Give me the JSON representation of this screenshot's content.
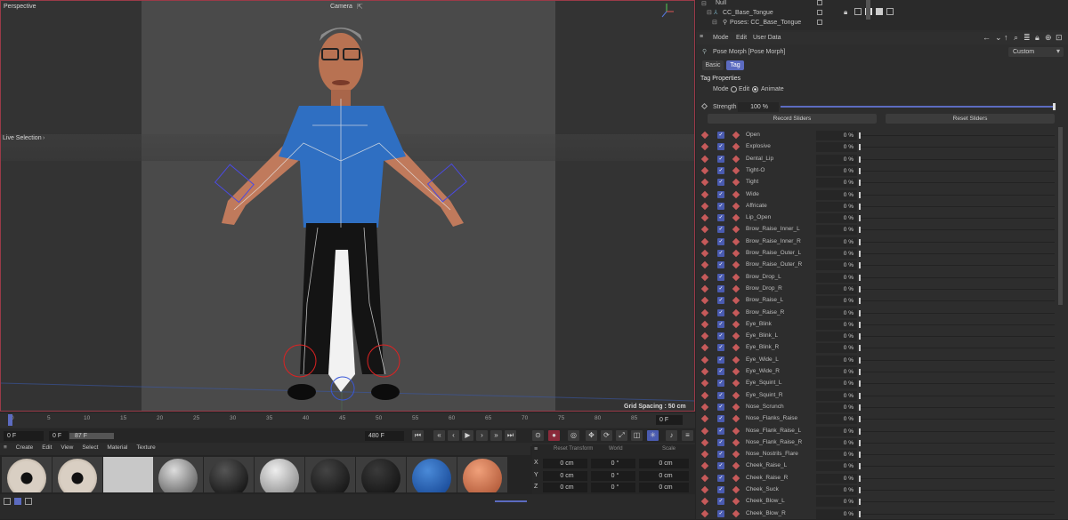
{
  "viewport": {
    "label_perspective": "Perspective",
    "label_camera": "Camera",
    "label_live_selection": "Live Selection",
    "grid_spacing": "Grid Spacing : 50 cm"
  },
  "timeline": {
    "ticks": [
      "0",
      "5",
      "10",
      "15",
      "20",
      "25",
      "30",
      "35",
      "40",
      "45",
      "50",
      "55",
      "60",
      "65",
      "70",
      "75",
      "80",
      "85",
      "90"
    ],
    "current_frame": "0 F",
    "field_start": "0 F",
    "field_min": "0 F",
    "field_max": "87 F",
    "field_end": "480 F"
  },
  "material_menu": [
    "Create",
    "Edit",
    "View",
    "Select",
    "Material",
    "Texture"
  ],
  "coords": {
    "headers": [
      "Reset Transform",
      "World",
      "Scale"
    ],
    "rows": [
      {
        "axis": "X",
        "pos": "0 cm",
        "rot": "0 °",
        "scale": "0 cm"
      },
      {
        "axis": "Y",
        "pos": "0 cm",
        "rot": "0 °",
        "scale": "0 cm"
      },
      {
        "axis": "Z",
        "pos": "0 cm",
        "rot": "0 °",
        "scale": "0 cm"
      }
    ]
  },
  "object_manager": {
    "items": [
      "Null",
      "CC_Base_Tongue",
      "Poses: CC_Base_Tongue"
    ]
  },
  "attributes": {
    "menu": [
      "Mode",
      "Edit",
      "User Data"
    ],
    "title": "Pose Morph [Pose Morph]",
    "preset": "Custom",
    "tabs": [
      "Basic",
      "Tag"
    ],
    "section": "Tag Properties",
    "mode_label": "Mode",
    "mode_edit": "Edit",
    "mode_animate": "Animate",
    "strength_label": "Strength",
    "strength_value": "100 %",
    "strength_fraction": 1.0,
    "record_btn": "Record Sliders",
    "reset_btn": "Reset Sliders"
  },
  "morphs": [
    {
      "name": "Open",
      "value": "0 %"
    },
    {
      "name": "Explosive",
      "value": "0 %"
    },
    {
      "name": "Dental_Lip",
      "value": "0 %"
    },
    {
      "name": "Tight-O",
      "value": "0 %"
    },
    {
      "name": "Tight",
      "value": "0 %"
    },
    {
      "name": "Wide",
      "value": "0 %"
    },
    {
      "name": "Affricate",
      "value": "0 %"
    },
    {
      "name": "Lip_Open",
      "value": "0 %"
    },
    {
      "name": "Brow_Raise_Inner_L",
      "value": "0 %"
    },
    {
      "name": "Brow_Raise_Inner_R",
      "value": "0 %"
    },
    {
      "name": "Brow_Raise_Outer_L",
      "value": "0 %"
    },
    {
      "name": "Brow_Raise_Outer_R",
      "value": "0 %"
    },
    {
      "name": "Brow_Drop_L",
      "value": "0 %"
    },
    {
      "name": "Brow_Drop_R",
      "value": "0 %"
    },
    {
      "name": "Brow_Raise_L",
      "value": "0 %"
    },
    {
      "name": "Brow_Raise_R",
      "value": "0 %"
    },
    {
      "name": "Eye_Blink",
      "value": "0 %"
    },
    {
      "name": "Eye_Blink_L",
      "value": "0 %"
    },
    {
      "name": "Eye_Blink_R",
      "value": "0 %"
    },
    {
      "name": "Eye_Wide_L",
      "value": "0 %"
    },
    {
      "name": "Eye_Wide_R",
      "value": "0 %"
    },
    {
      "name": "Eye_Squint_L",
      "value": "0 %"
    },
    {
      "name": "Eye_Squint_R",
      "value": "0 %"
    },
    {
      "name": "Nose_Scrunch",
      "value": "0 %"
    },
    {
      "name": "Nose_Flanks_Raise",
      "value": "0 %"
    },
    {
      "name": "Nose_Flank_Raise_L",
      "value": "0 %"
    },
    {
      "name": "Nose_Flank_Raise_R",
      "value": "0 %"
    },
    {
      "name": "Nose_Nostrils_Flare",
      "value": "0 %"
    },
    {
      "name": "Cheek_Raise_L",
      "value": "0 %"
    },
    {
      "name": "Cheek_Raise_R",
      "value": "0 %"
    },
    {
      "name": "Cheek_Suck",
      "value": "0 %"
    },
    {
      "name": "Cheek_Blow_L",
      "value": "0 %"
    },
    {
      "name": "Cheek_Blow_R",
      "value": "0 %"
    }
  ],
  "colors": {
    "accent": "#5c6bc0",
    "keyframe": "#c65a5a",
    "viewport_border": "#9a3a48"
  }
}
